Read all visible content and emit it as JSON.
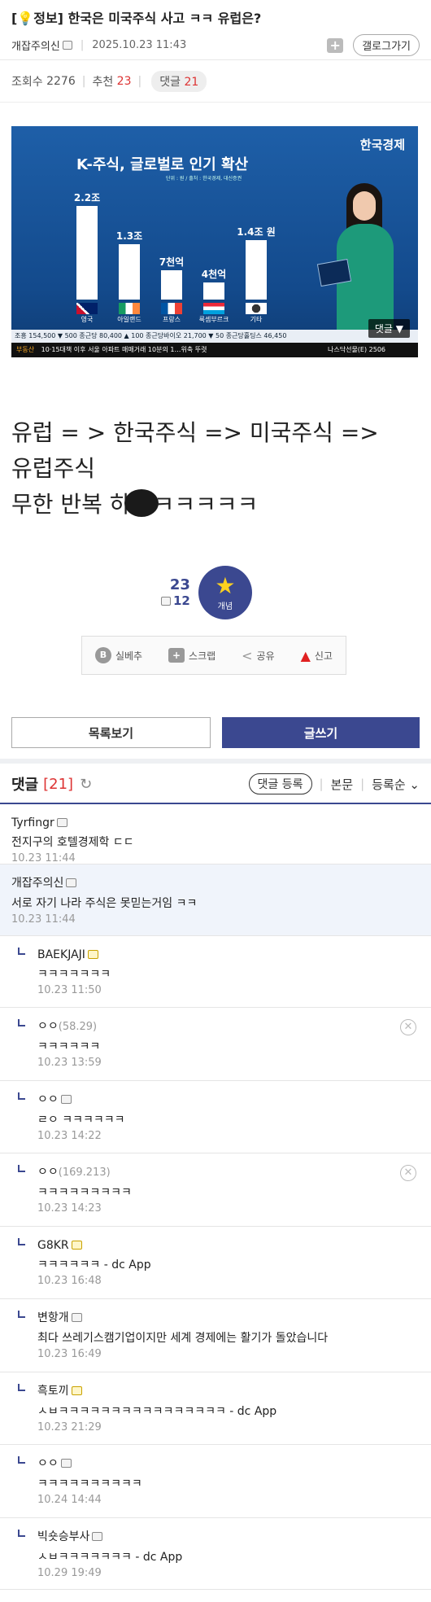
{
  "post": {
    "category": "[💡정보]",
    "title": "한국은 미국주식 사고 ㅋㅋ 유럽은?",
    "author": "개잡주의신",
    "date": "2025.10.23 11:43",
    "gallery_button": "갤로그가기"
  },
  "stats": {
    "views_label": "조회수",
    "views": "2276",
    "recommend_label": "추천",
    "recommend": "23",
    "comments_label": "댓글",
    "comments": "21"
  },
  "video": {
    "brand": "한국경제",
    "chart_title": "K-주식, 글로벌로 인기 확산",
    "chart_note": "단위 : 원 / 출처 : 한국경제, 대신증권",
    "ticker_text": "조흥 154,500 ▼ 500   종근당 80,400 ▲ 100   종근당바이오 21,700 ▼ 50   종근당홀딩스 46,450",
    "news_tag": "부동산",
    "news_text": "10·15대책 이후 서울 아파트 매매거래 10분의 1…위축 뚜렷",
    "index_text": "나스닥선물(E) 2506",
    "comment_overlay": "댓글 ▼"
  },
  "chart_data": {
    "type": "bar",
    "title": "K-주식, 글로벌로 인기 확산",
    "categories": [
      "영국",
      "아일랜드",
      "프랑스",
      "룩셈부르크",
      "기타"
    ],
    "value_labels": [
      "2.2조",
      "1.3조",
      "7천억",
      "4천억",
      "1.4조 원"
    ],
    "values": [
      2.2,
      1.3,
      0.7,
      0.4,
      1.4
    ],
    "ylim": [
      0,
      2.4
    ]
  },
  "body": {
    "line1": "유럽 = > 한국주식 => 미국주식 =>",
    "line2": "유럽주식",
    "line3a": "무한 반복 하",
    "line3b": "ㅋㅋㅋㅋㅋ"
  },
  "vote": {
    "up": "23",
    "fixed": "12",
    "button": "개념"
  },
  "share": {
    "best": "실베추",
    "scrap": "스크랩",
    "share": "공유",
    "report": "신고"
  },
  "buttons": {
    "list": "목록보기",
    "write": "글쓰기"
  },
  "comment_header": {
    "label": "댓글",
    "count": "[21]",
    "register": "댓글 등록",
    "body": "본문",
    "sort": "등록순"
  },
  "comments": [
    {
      "nick": "Tyrfingr",
      "ip": "",
      "text": "전지구의 호텔경제학 ㄷㄷ",
      "time": "10.23 11:44"
    },
    {
      "nick": "개잡주의신",
      "ip": "",
      "text": "서로 자기 나라 주식은 못믿는거임 ㅋㅋ",
      "time": "10.23 11:44"
    },
    {
      "nick": "BAEKJAJI",
      "ip": "",
      "text": "ㅋㅋㅋㅋㅋㅋㅋ",
      "time": "10.23 11:50"
    },
    {
      "nick": "ㅇㅇ",
      "ip": "(58.29)",
      "text": "ㅋㅋㅋㅋㅋㅋ",
      "time": "10.23 13:59"
    },
    {
      "nick": "ㅇㅇ",
      "ip": "",
      "text": "ㄹㅇ ㅋㅋㅋㅋㅋㅋ",
      "time": "10.23 14:22"
    },
    {
      "nick": "ㅇㅇ",
      "ip": "(169.213)",
      "text": "ㅋㅋㅋㅋㅋㅋㅋㅋㅋ",
      "time": "10.23 14:23"
    },
    {
      "nick": "G8KR",
      "ip": "",
      "text": "ㅋㅋㅋㅋㅋㅋ - dc App",
      "time": "10.23 16:48"
    },
    {
      "nick": "변항개",
      "ip": "",
      "text": "최다 쓰레기스캠기업이지만 세계 경제에는 활기가 돌았습니다",
      "time": "10.23 16:49"
    },
    {
      "nick": "흑토끼",
      "ip": "",
      "text": "ㅅㅂㅋㅋㅋㅋㅋㅋㅋㅋㅋㅋㅋㅋㅋㅋㅋㅋ - dc App",
      "time": "10.23 21:29"
    },
    {
      "nick": "ㅇㅇ",
      "ip": "",
      "text": "ㅋㅋㅋㅋㅋㅋㅋㅋㅋㅋ",
      "time": "10.24 14:44"
    },
    {
      "nick": "빅숏승부사",
      "ip": "",
      "text": "ㅅㅂㅋㅋㅋㅋㅋㅋㅋ - dc App",
      "time": "10.29 19:49"
    }
  ]
}
